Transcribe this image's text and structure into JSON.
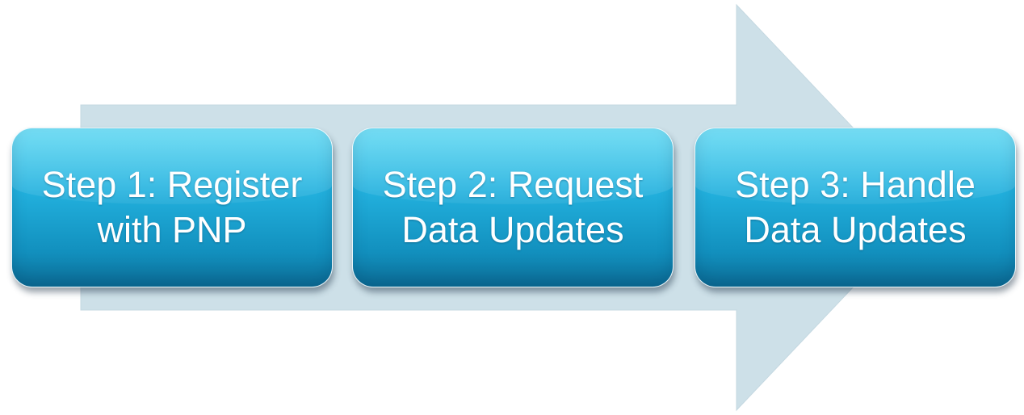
{
  "diagram": {
    "type": "process-arrow",
    "arrow_color": "#cde0e8",
    "box_color": "#1aa6d6",
    "text_color": "#ffffff",
    "steps": [
      {
        "label": "Step 1: Register\nwith PNP"
      },
      {
        "label": "Step 2: Request\nData Updates"
      },
      {
        "label": "Step 3: Handle\nData Updates"
      }
    ]
  }
}
